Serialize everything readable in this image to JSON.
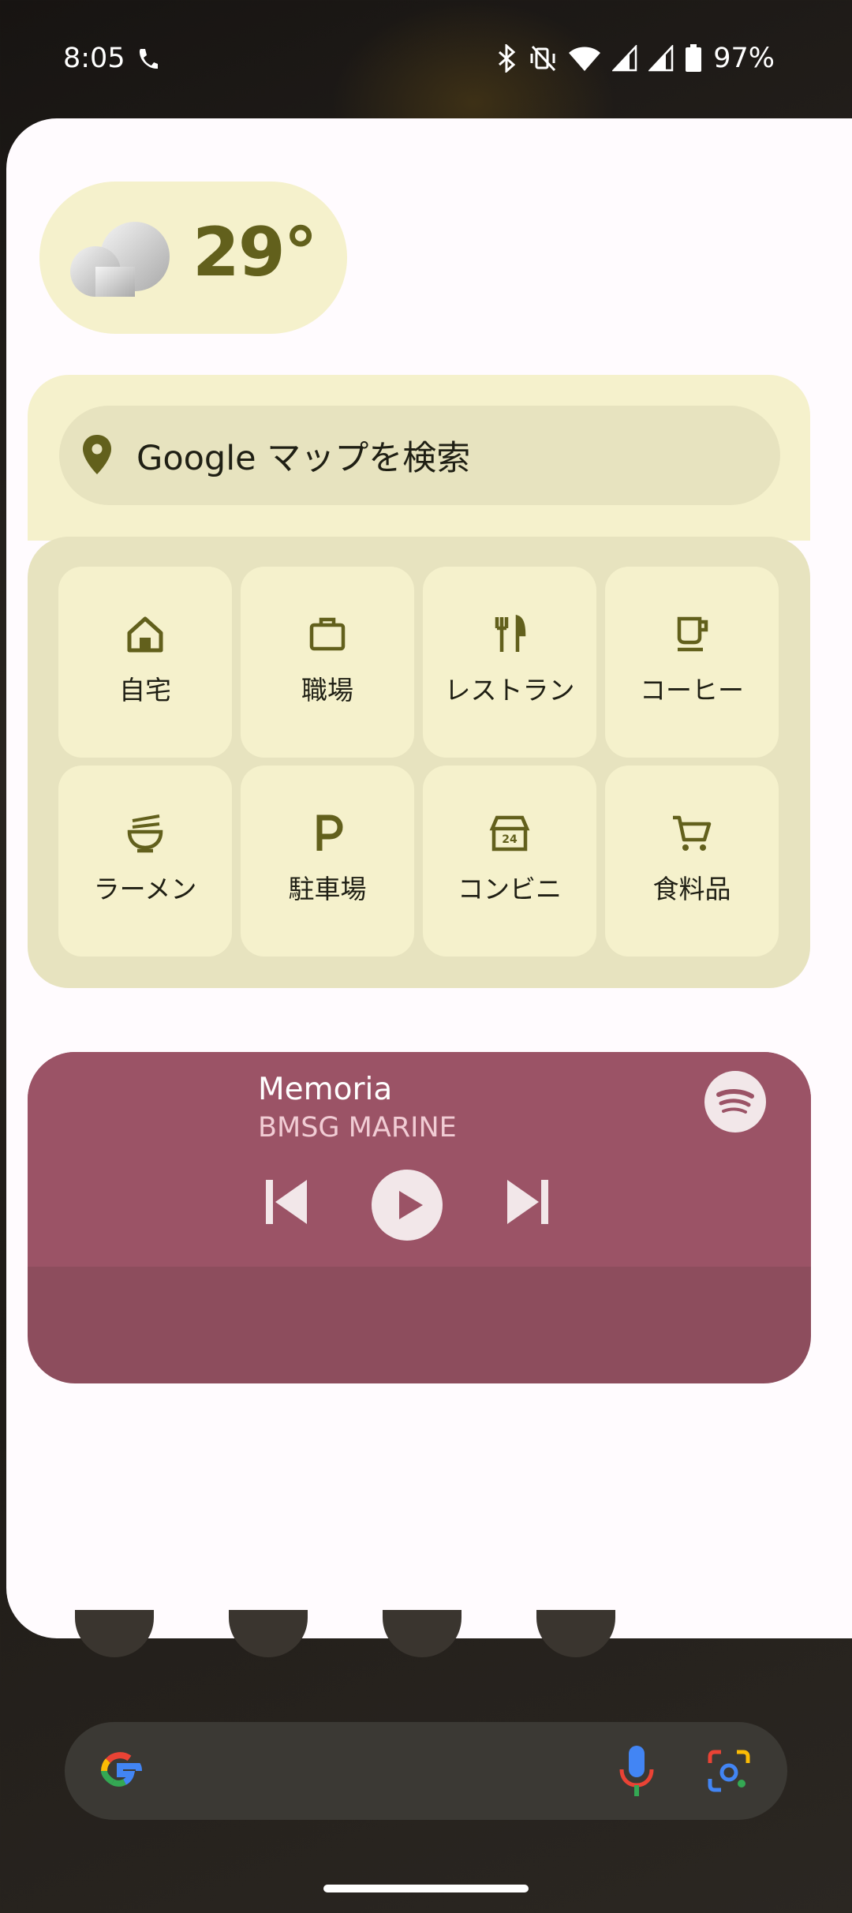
{
  "status_bar": {
    "time": "8:05",
    "battery": "97%",
    "icons": [
      "call-forwarded-icon",
      "bluetooth-icon",
      "vibrate-off-icon",
      "wifi-icon",
      "signal-icon",
      "signal-icon",
      "battery-icon"
    ]
  },
  "weather": {
    "temperature": "29°",
    "icon": "cloud-icon"
  },
  "maps": {
    "search_placeholder": "Google マップを検索",
    "shortcuts": [
      {
        "label": "自宅",
        "icon": "home-icon"
      },
      {
        "label": "職場",
        "icon": "briefcase-icon"
      },
      {
        "label": "レストラン",
        "icon": "restaurant-icon"
      },
      {
        "label": "コーヒー",
        "icon": "coffee-icon"
      },
      {
        "label": "ラーメン",
        "icon": "ramen-icon"
      },
      {
        "label": "駐車場",
        "icon": "parking-icon"
      },
      {
        "label": "コンビニ",
        "icon": "convenience-store-icon"
      },
      {
        "label": "食料品",
        "icon": "cart-icon"
      }
    ]
  },
  "music": {
    "title": "Memoria",
    "artist": "BMSG MARINE",
    "app_icon": "spotify-icon"
  },
  "colors": {
    "widget_bg": "#f5f1cc",
    "widget_bg_dark": "#e7e3bf",
    "accent_olive": "#62601c",
    "music_bg": "#9b5366"
  }
}
